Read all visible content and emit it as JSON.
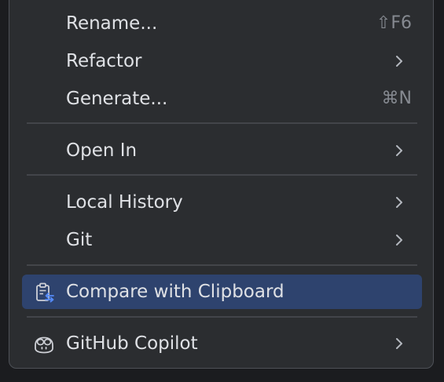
{
  "menu": {
    "items": [
      {
        "label": "Rename...",
        "shortcut": "⇧F6"
      },
      {
        "label": "Refactor",
        "submenu": true
      },
      {
        "label": "Generate...",
        "shortcut": "⌘N"
      },
      {
        "label": "Open In",
        "submenu": true
      },
      {
        "label": "Local History",
        "submenu": true
      },
      {
        "label": "Git",
        "submenu": true
      },
      {
        "label": "Compare with Clipboard",
        "selected": true,
        "icon": "clipboard-compare-icon"
      },
      {
        "label": "GitHub Copilot",
        "submenu": true,
        "icon": "copilot-icon"
      }
    ]
  },
  "colors": {
    "background": "#2b2d30",
    "selected": "#2e436e",
    "text": "#dfe1e5",
    "shortcut": "#868a91",
    "separator": "#43454a",
    "icon_accent": "#548af7"
  }
}
